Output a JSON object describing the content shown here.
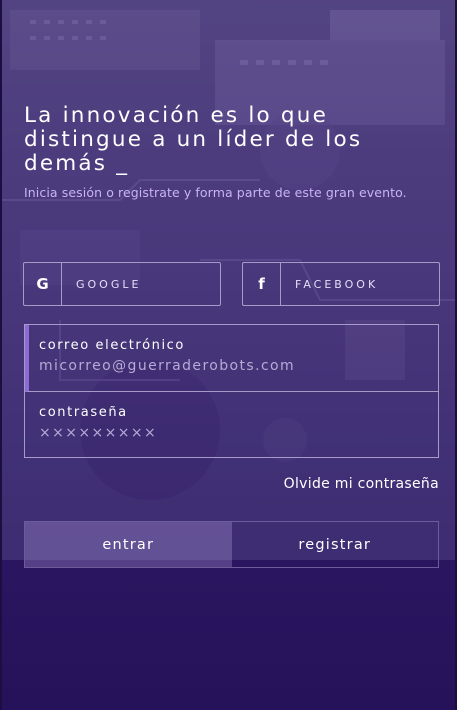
{
  "hero": {
    "headline": "La innovación es lo que distingue a un líder de los demás _",
    "subline": "Inicia sesión o registrate y forma parte de este gran evento."
  },
  "social": {
    "google": {
      "icon": "google-g-icon",
      "glyph": "G",
      "label": "GOOGLE"
    },
    "facebook": {
      "icon": "facebook-f-icon",
      "glyph": "f",
      "label": "FACEBOOK"
    }
  },
  "form": {
    "email": {
      "label": "correo electrónico",
      "placeholder": "micorreo@guerraderobots.com"
    },
    "password": {
      "label": "contraseña",
      "placeholder": "×××××××××"
    },
    "forgot_label": "Olvide mi contraseña"
  },
  "actions": {
    "login_label": "entrar",
    "register_label": "registrar"
  },
  "colors": {
    "accent": "#8c6bd6",
    "subtitle": "#c9b3f5",
    "border": "#a79ac8"
  }
}
